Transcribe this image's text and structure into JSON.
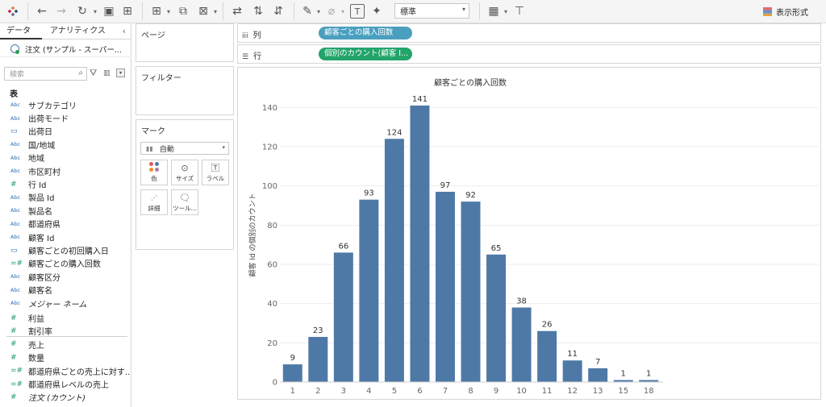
{
  "toolbar": {
    "format_select": "標準",
    "show_me_label": "表示形式"
  },
  "left_panel": {
    "tabs": [
      "データ",
      "アナリティクス"
    ],
    "datasource": "注文 (サンプル - スーパー...",
    "search_placeholder": "検索",
    "table_header": "表",
    "fields": [
      {
        "icon": "Abc",
        "label": "サブカテゴリ"
      },
      {
        "icon": "Abc",
        "label": "出荷モード"
      },
      {
        "icon": "date",
        "label": "出荷日"
      },
      {
        "icon": "Abc",
        "label": "国/地域"
      },
      {
        "icon": "Abc",
        "label": "地域"
      },
      {
        "icon": "Abc",
        "label": "市区町村"
      },
      {
        "icon": "#",
        "label": "行 Id"
      },
      {
        "icon": "Abc",
        "label": "製品 Id"
      },
      {
        "icon": "Abc",
        "label": "製品名"
      },
      {
        "icon": "Abc",
        "label": "都道府県"
      },
      {
        "icon": "Abc",
        "label": "顧客 Id"
      },
      {
        "icon": "=date",
        "label": "顧客ごとの初回購入日"
      },
      {
        "icon": "=#",
        "label": "顧客ごとの購入回数"
      },
      {
        "icon": "Abc",
        "label": "顧客区分"
      },
      {
        "icon": "Abc",
        "label": "顧客名"
      },
      {
        "icon": "Abc",
        "label": "メジャー ネーム"
      },
      {
        "icon": "#",
        "label": "利益"
      },
      {
        "icon": "#",
        "label": "割引率"
      },
      {
        "icon": "#",
        "label": "売上"
      },
      {
        "icon": "#",
        "label": "数量"
      },
      {
        "icon": "=#",
        "label": "都道府県ごとの売上に対す..."
      },
      {
        "icon": "=#",
        "label": "都道府県レベルの売上"
      },
      {
        "icon": "=",
        "label": "注文 (カウント)"
      }
    ]
  },
  "cards": {
    "pages_title": "ページ",
    "filters_title": "フィルター",
    "marks_title": "マーク",
    "mark_type": "自動",
    "mark_buttons": [
      "色",
      "サイズ",
      "ラベル",
      "詳細",
      "ツール..."
    ]
  },
  "shelves": {
    "columns_label": "列",
    "columns_pill": "顧客ごとの購入回数",
    "rows_label": "行",
    "rows_pill": "個別のカウント(顧客 I..."
  },
  "chart_data": {
    "type": "bar",
    "title": "顧客ごとの購入回数",
    "xlabel": "",
    "ylabel": "顧客 Id の個別のカウント",
    "categories": [
      "1",
      "2",
      "3",
      "4",
      "5",
      "6",
      "7",
      "8",
      "9",
      "10",
      "11",
      "12",
      "13",
      "15",
      "18"
    ],
    "values": [
      9,
      23,
      66,
      93,
      124,
      141,
      97,
      92,
      65,
      38,
      26,
      11,
      7,
      1,
      1
    ],
    "yticks": [
      0,
      20,
      40,
      60,
      80,
      100,
      120,
      140
    ],
    "ylim": [
      0,
      150
    ],
    "bar_color": "#4e79a7",
    "grid": true
  }
}
